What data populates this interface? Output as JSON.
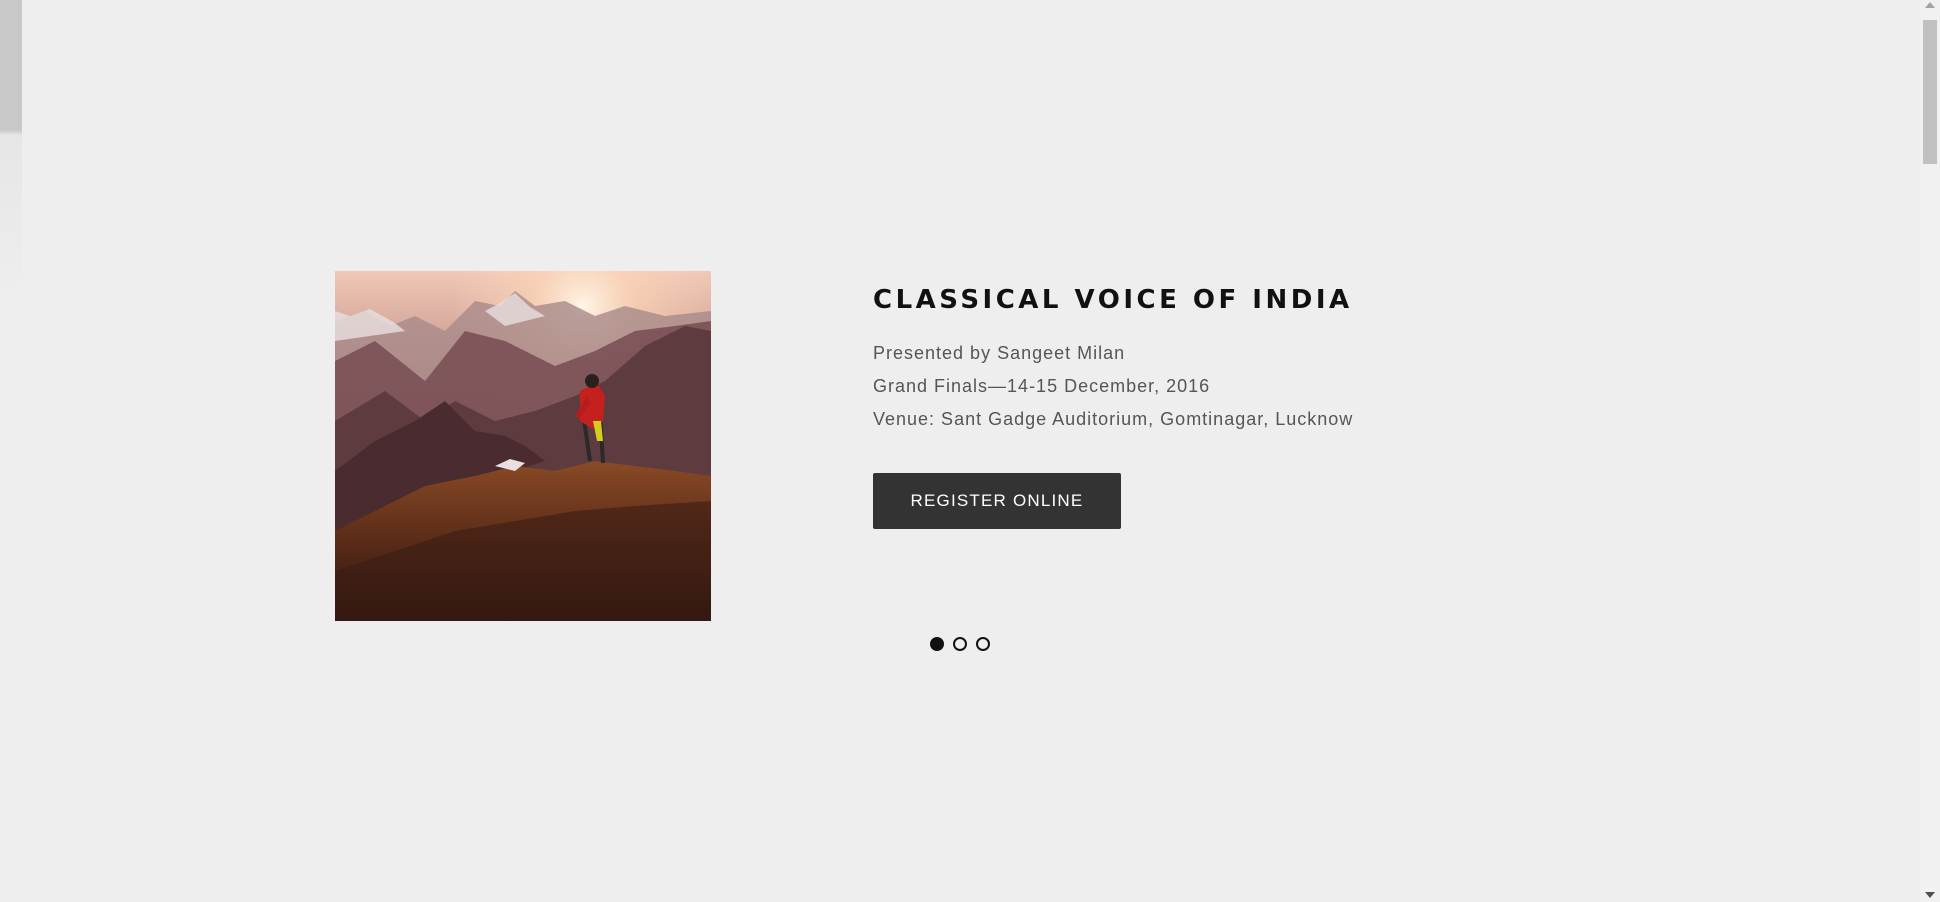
{
  "slide": {
    "title": "CLASSICAL VOICE OF INDIA",
    "presenter": "Presented by Sangeet Milan",
    "dates": "Grand Finals—14-15 December, 2016",
    "venue": "Venue: Sant Gadge Auditorium, Gomtinagar, Lucknow",
    "register_label": "REGISTER ONLINE",
    "image_alt": "mountain-biker-on-ridge-at-sunset"
  },
  "carousel": {
    "total_slides": 3,
    "active_index": 0
  },
  "colors": {
    "background": "#eeeeee",
    "title": "#111111",
    "body_text": "#555555",
    "button_bg": "#333333",
    "button_text": "#ffffff"
  }
}
